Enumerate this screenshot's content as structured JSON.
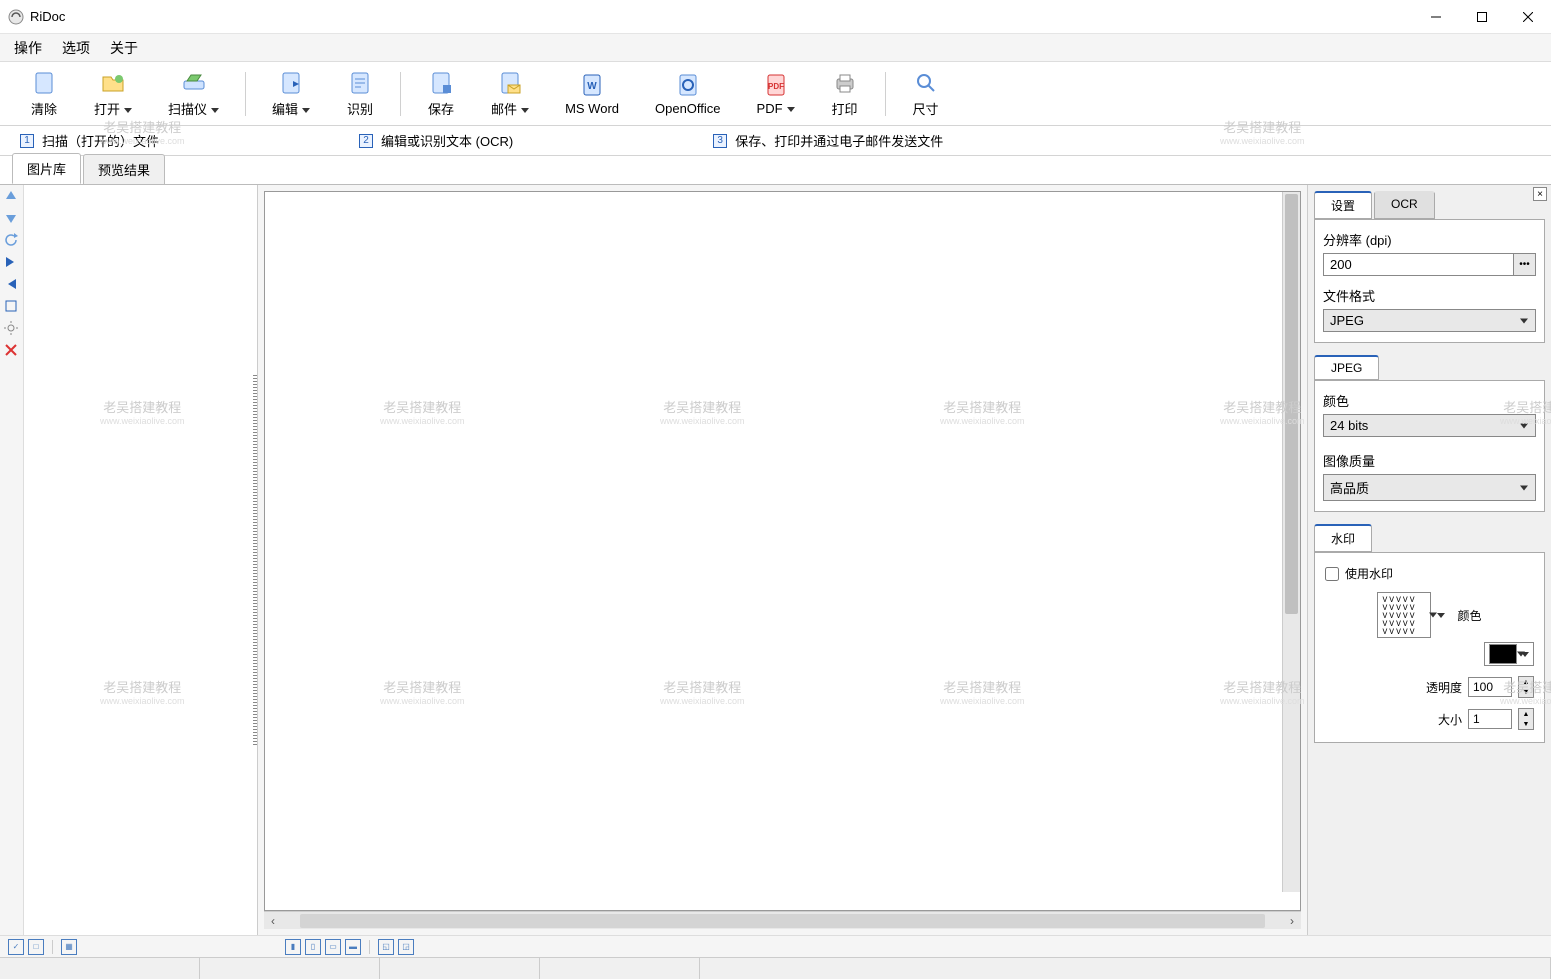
{
  "app": {
    "title": "RiDoc"
  },
  "menu": {
    "actions": "操作",
    "options": "选项",
    "about": "关于"
  },
  "toolbar": {
    "clear": "清除",
    "open": "打开",
    "scanner": "扫描仪",
    "edit": "编辑",
    "recognize": "识别",
    "save": "保存",
    "mail": "邮件",
    "msword": "MS Word",
    "openoffice": "OpenOffice",
    "pdf": "PDF",
    "print": "打印",
    "size": "尺寸"
  },
  "steps": {
    "s1": "扫描（打开的）文件",
    "s2": "编辑或识别文本 (OCR)",
    "s3": "保存、打印并通过电子邮件发送文件"
  },
  "mainTabs": {
    "gallery": "图片库",
    "preview": "预览结果"
  },
  "rightTabs": {
    "settings": "设置",
    "ocr": "OCR"
  },
  "settings": {
    "resolutionLabel": "分辨率 (dpi)",
    "resolutionValue": "200",
    "formatLabel": "文件格式",
    "formatValue": "JPEG",
    "jpegTab": "JPEG",
    "colorLabel": "颜色",
    "colorValue": "24 bits",
    "qualityLabel": "图像质量",
    "qualityValue": "高品质",
    "watermarkTab": "水印",
    "useWatermark": "使用水印",
    "wmColorLabel": "颜色",
    "opacityLabel": "透明度",
    "opacityValue": "100",
    "sizeLabel": "大小",
    "sizeValue": "1"
  },
  "watermark": {
    "text": "老吴搭建教程",
    "url": "www.weixiaolive.com"
  }
}
